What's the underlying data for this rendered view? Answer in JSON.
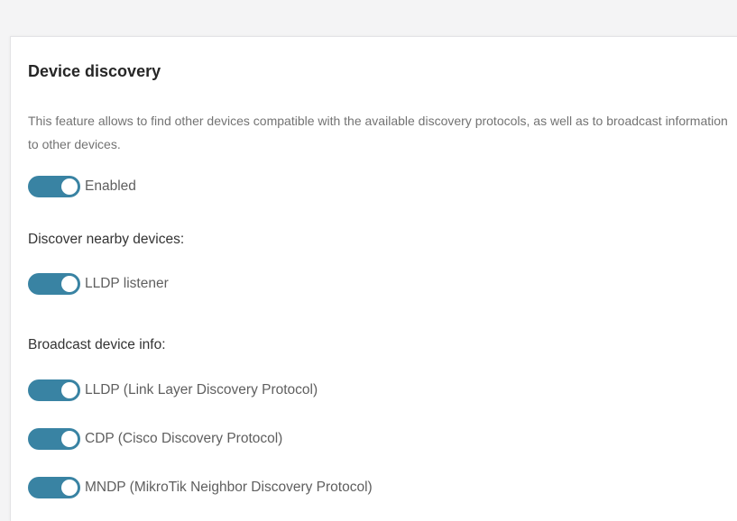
{
  "section": {
    "title": "Device discovery",
    "description": "This feature allows to find other devices compatible with the available discovery protocols, as well as to broadcast information to other devices."
  },
  "enabled_toggle": {
    "label": "Enabled",
    "on": true
  },
  "discover": {
    "heading": "Discover nearby devices:",
    "toggles": [
      {
        "label": "LLDP listener",
        "on": true
      }
    ]
  },
  "broadcast": {
    "heading": "Broadcast device info:",
    "toggles": [
      {
        "label": "LLDP (Link Layer Discovery Protocol)",
        "on": true
      },
      {
        "label": "CDP (Cisco Discovery Protocol)",
        "on": true
      },
      {
        "label": "MNDP (MikroTik Neighbor Discovery Protocol)",
        "on": true
      }
    ]
  },
  "colors": {
    "toggle_on": "#3983a3",
    "title_text": "#262626",
    "muted_text": "#737373"
  }
}
